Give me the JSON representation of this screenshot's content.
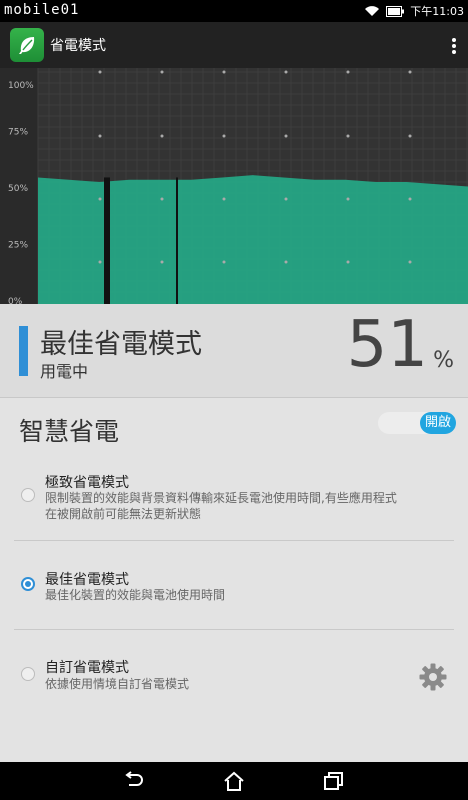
{
  "status_bar": {
    "watermark": "mobile01",
    "time": "下午11:03"
  },
  "app_bar": {
    "title": "省電模式"
  },
  "chart_data": {
    "type": "area",
    "ylim": [
      0,
      100
    ],
    "ytick_labels": [
      "100%",
      "75%",
      "50%",
      "25%",
      "0%"
    ],
    "x": [
      0,
      1,
      2,
      3,
      4,
      5,
      6,
      7,
      8,
      9,
      10,
      11,
      12,
      13,
      14
    ],
    "series": [
      {
        "values": [
          56,
          55,
          54,
          55,
          55,
          55,
          56,
          57,
          56,
          55,
          55,
          54,
          54,
          53,
          52
        ]
      }
    ],
    "color": "#25a585",
    "grid": true
  },
  "current_mode": {
    "title": "最佳省電模式",
    "subtitle": "用電中",
    "percent": "51",
    "percent_sign": "%",
    "accent_color": "#2f8fd6"
  },
  "smart_saving": {
    "label": "智慧省電",
    "toggle_label": "開啟",
    "toggle_color": "#21a5e0"
  },
  "options": [
    {
      "title": "極致省電模式",
      "desc_line1": "限制裝置的效能與背景資料傳輸來延長電池使用時間,有些應用程式",
      "desc_line2": "在被開啟前可能無法更新狀態",
      "selected": false
    },
    {
      "title": "最佳省電模式",
      "desc_line1": "最佳化裝置的效能與電池使用時間",
      "selected": true
    },
    {
      "title": "自訂省電模式",
      "desc_line1": "依據使用情境自訂省電模式",
      "selected": false
    }
  ]
}
